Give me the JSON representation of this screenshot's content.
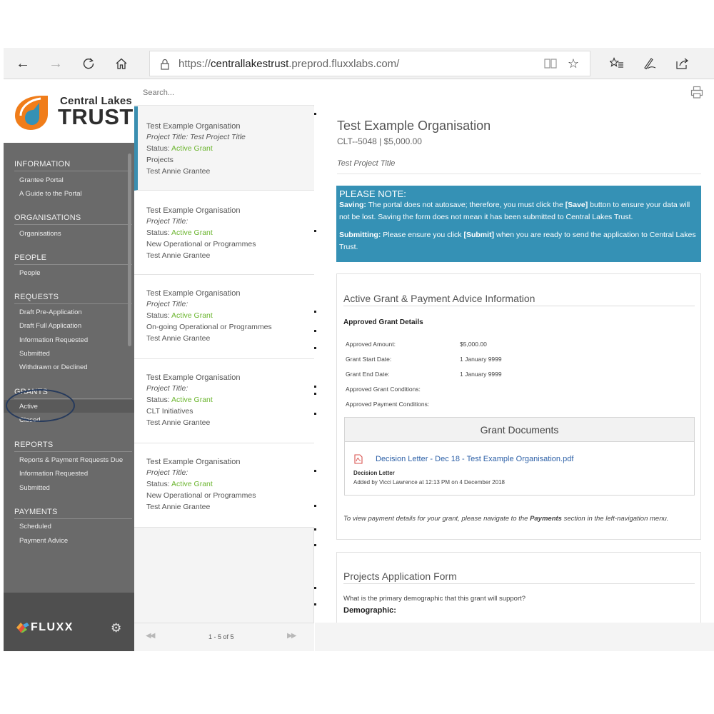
{
  "browser": {
    "url_prefix": "https://",
    "url_host": "centrallakestrust",
    "url_rest": ".preprod.fluxxlabs.com/"
  },
  "brand": {
    "logo_line1": "Central Lakes",
    "logo_line2": "TRUST",
    "platform": "FLUXX",
    "accent": "#3591b5",
    "orange": "#f07d1a",
    "status_green": "#6bb52e"
  },
  "sidebar": {
    "information": "INFORMATION",
    "grantee_portal": "Grantee Portal",
    "guide": "A Guide to the Portal",
    "organisations_head": "ORGANISATIONS",
    "organisations": "Organisations",
    "people_head": "PEOPLE",
    "people": "People",
    "requests_head": "REQUESTS",
    "draft_pre": "Draft Pre-Application",
    "draft_full": "Draft Full Application",
    "info_requested": "Information Requested",
    "submitted": "Submitted",
    "withdrawn": "Withdrawn or Declined",
    "grants_head": "GRANTS",
    "active": "Active",
    "closed": "Closed",
    "reports_head": "REPORTS",
    "reports_due": "Reports & Payment Requests Due",
    "reports_info": "Information Requested",
    "reports_submitted": "Submitted",
    "payments_head": "PAYMENTS",
    "scheduled": "Scheduled",
    "payment_advice": "Payment Advice"
  },
  "list": {
    "search_placeholder": "Search...",
    "cards": [
      {
        "org": "Test Example Organisation",
        "title": "Project Title: Test Project Title",
        "status_label": "Status: ",
        "status": "Active Grant",
        "program": "Projects",
        "grantee": "Test Annie Grantee"
      },
      {
        "org": "Test Example Organisation",
        "title": "Project Title:",
        "status_label": "Status: ",
        "status": "Active Grant",
        "program": "New Operational or Programmes",
        "grantee": "Test Annie Grantee"
      },
      {
        "org": "Test Example Organisation",
        "title": "Project Title:",
        "status_label": "Status: ",
        "status": "Active Grant",
        "program": "On-going Operational or Programmes",
        "grantee": "Test Annie Grantee"
      },
      {
        "org": "Test Example Organisation",
        "title": "Project Title:",
        "status_label": "Status: ",
        "status": "Active Grant",
        "program": "CLT Initiatives",
        "grantee": "Test Annie Grantee"
      },
      {
        "org": "Test Example Organisation",
        "title": "Project Title:",
        "status_label": "Status: ",
        "status": "Active Grant",
        "program": "New Operational or Programmes",
        "grantee": "Test Annie Grantee"
      }
    ],
    "pager": "1 - 5 of 5"
  },
  "detail": {
    "title": "Test Example Organisation",
    "subtitle": "CLT--5048 | $5,000.00",
    "project_title": "Test Project Title",
    "note": {
      "heading": "PLEASE NOTE:",
      "saving_label": "Saving:",
      "saving_text_1": " The portal does not autosave; therefore, you must click the ",
      "save_btn": "[Save]",
      "saving_text_2": " button to ensure your data will not be lost. Saving the form does not mean it has been submitted to Central Lakes Trust.",
      "submitting_label": "Submitting:",
      "submitting_text_1": " Please ensure you click ",
      "submit_btn": "[Submit]",
      "submitting_text_2": " when you are ready to send the application to Central Lakes Trust."
    },
    "grant": {
      "heading": "Active Grant & Payment Advice Information",
      "approved_heading": "Approved Grant Details",
      "rows": [
        {
          "label": "Approved Amount:",
          "value": "$5,000.00"
        },
        {
          "label": "Grant Start Date:",
          "value": "1 January 9999"
        },
        {
          "label": "Grant End Date:",
          "value": "1 January 9999"
        },
        {
          "label": "Approved Grant Conditions:",
          "value": ""
        },
        {
          "label": "Approved Payment Conditions:",
          "value": ""
        }
      ],
      "documents_heading": "Grant Documents",
      "doc_name": "Decision Letter - Dec 18 - Test Example Organisation.pdf",
      "doc_type": "Decision Letter",
      "doc_added": "Added by Vicci Lawrence at 12:13 PM on 4 December 2018",
      "pay_note_1": "To view payment details for your grant, please navigate to the ",
      "pay_note_bold": "Payments",
      "pay_note_2": " section in the left-navigation menu."
    },
    "projects": {
      "heading": "Projects Application Form",
      "question": "What is the primary demographic that this grant will support?",
      "demographic_label": "Demographic:"
    }
  }
}
